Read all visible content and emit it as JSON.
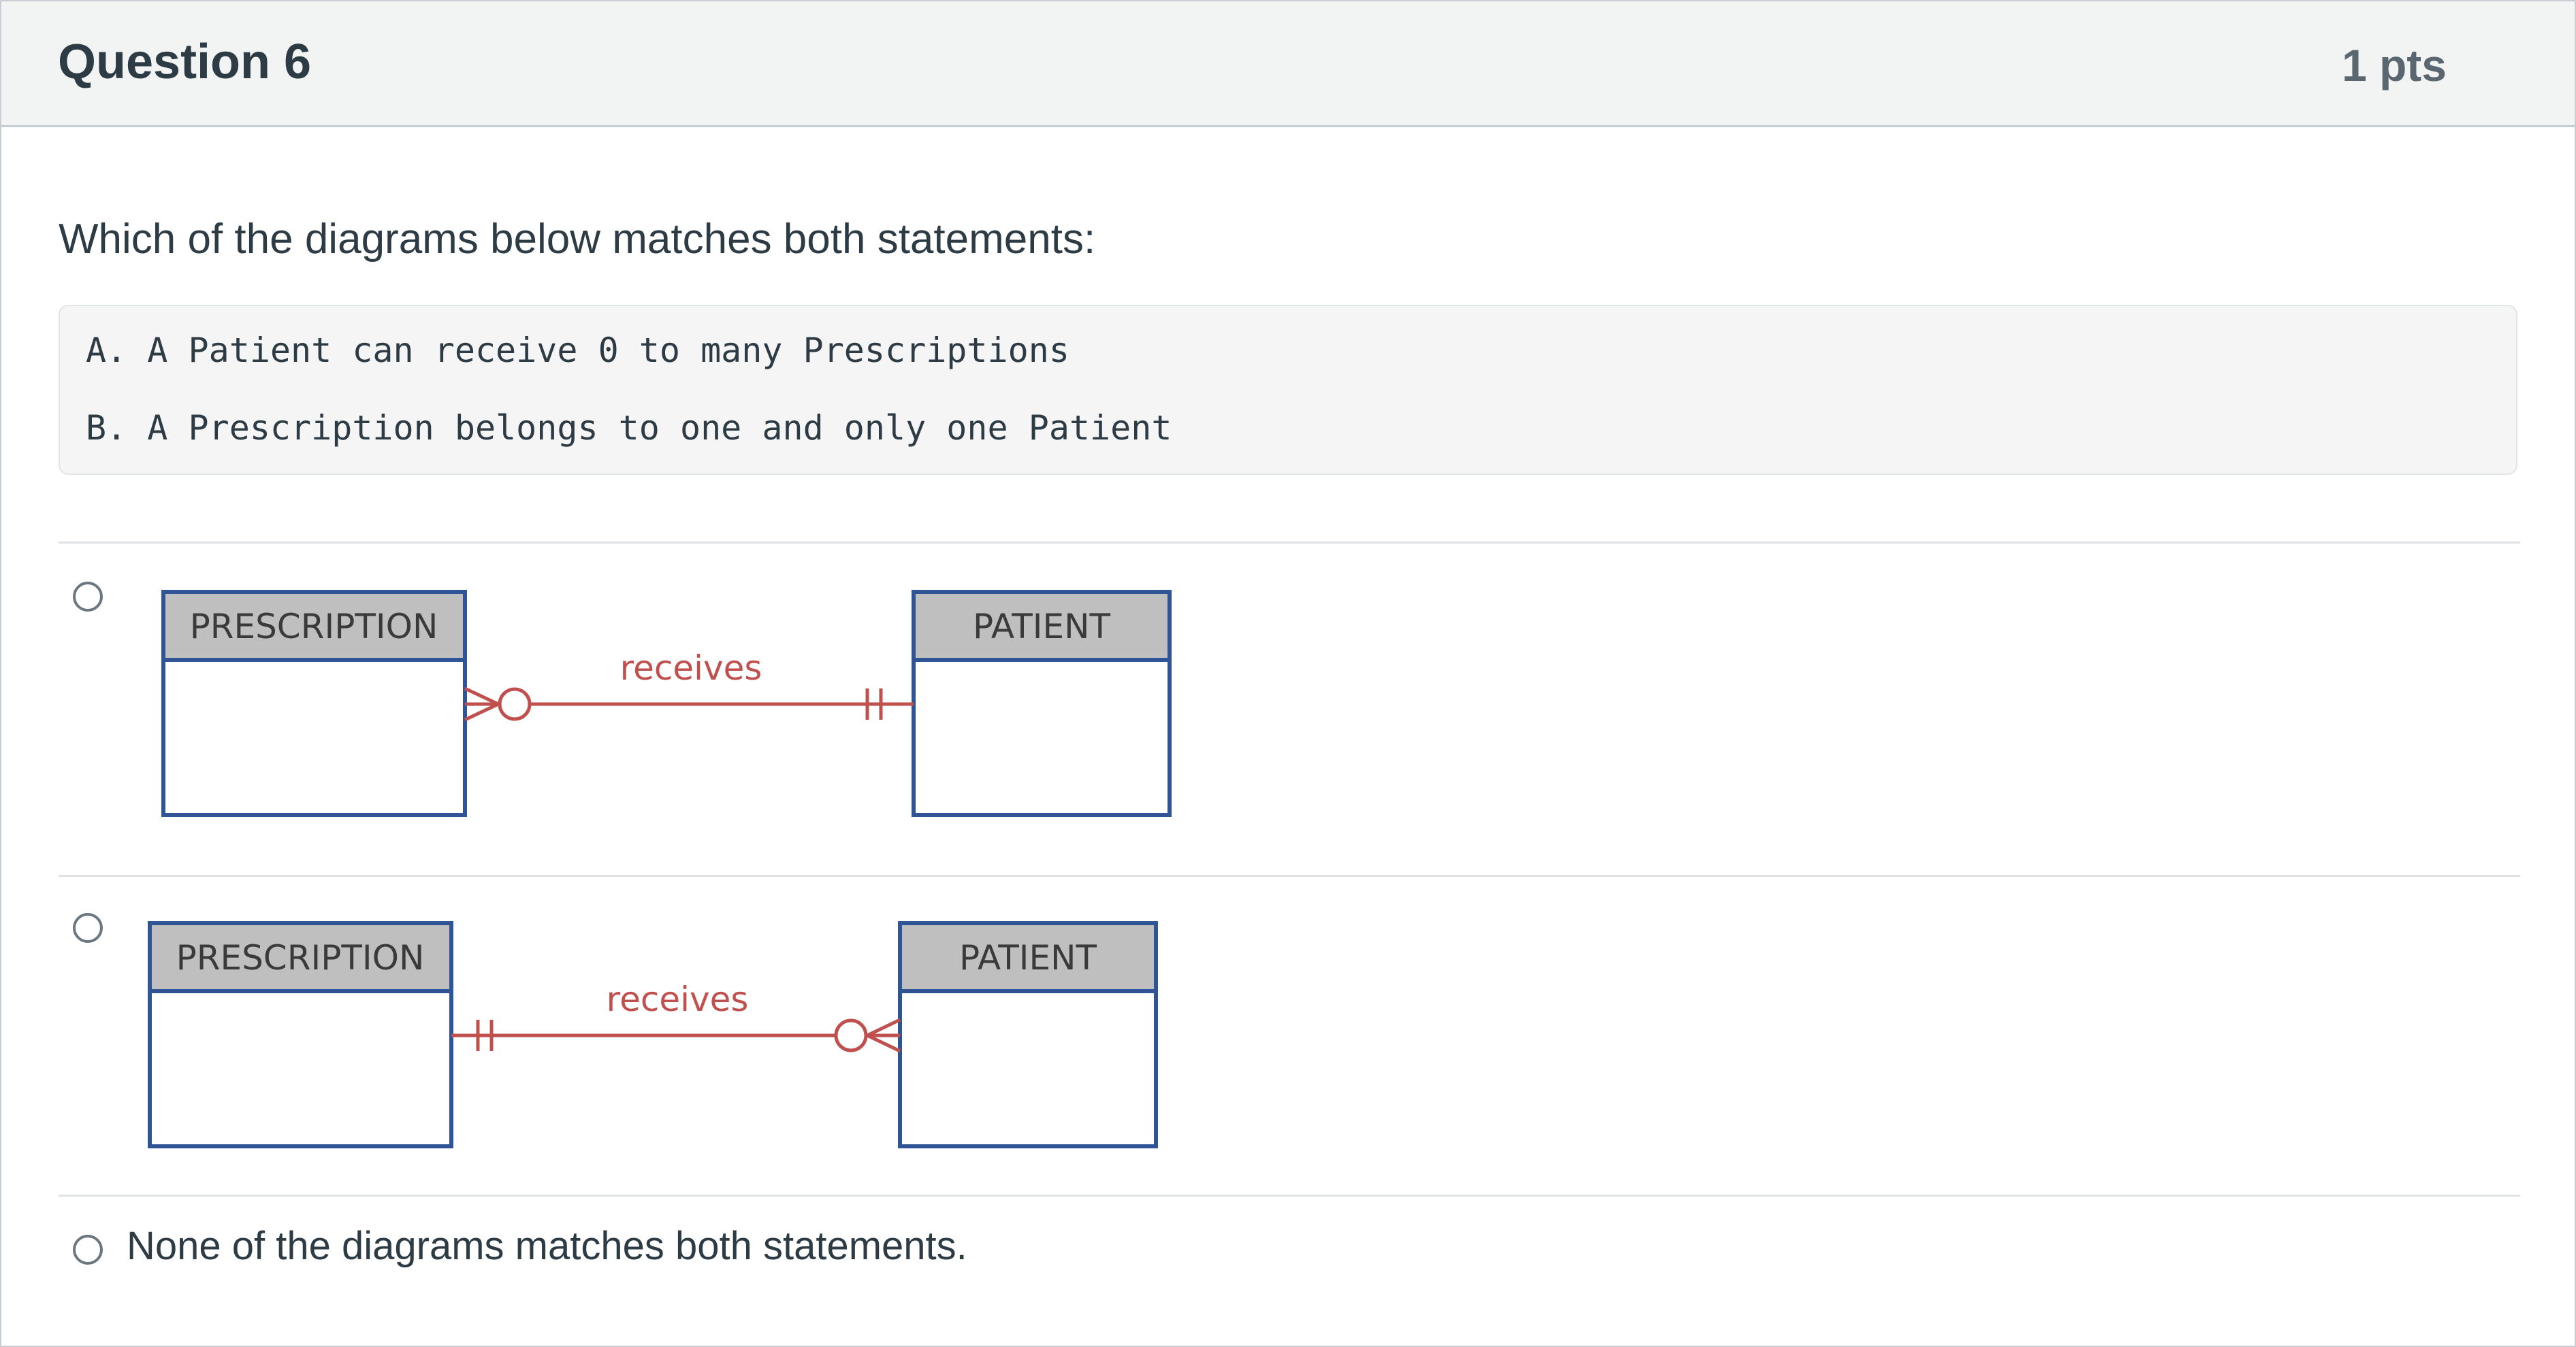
{
  "question": {
    "title": "Question 6",
    "points": "1 pts",
    "prompt": "Which of the diagrams below matches both statements:",
    "statements": [
      "A. A Patient can receive 0 to many Prescriptions",
      "B. A Prescription belongs to one and only one Patient"
    ]
  },
  "options": [
    {
      "diagram": {
        "left_entity": "PRESCRIPTION",
        "right_entity": "PATIENT",
        "relationship": "receives",
        "left_end": "zero-or-many-crowfoot",
        "right_end": "one-and-only-one"
      }
    },
    {
      "diagram": {
        "left_entity": "PRESCRIPTION",
        "right_entity": "PATIENT",
        "relationship": "receives",
        "left_end": "one-and-only-one",
        "right_end": "zero-or-many-crowfoot"
      }
    },
    {
      "label": "None of the diagrams matches both statements."
    }
  ],
  "colors": {
    "entity_header_fill": "#bfbfbf",
    "entity_border": "#2f5597",
    "relationship_line": "#c0504d",
    "header_background": "#f2f4f4"
  }
}
